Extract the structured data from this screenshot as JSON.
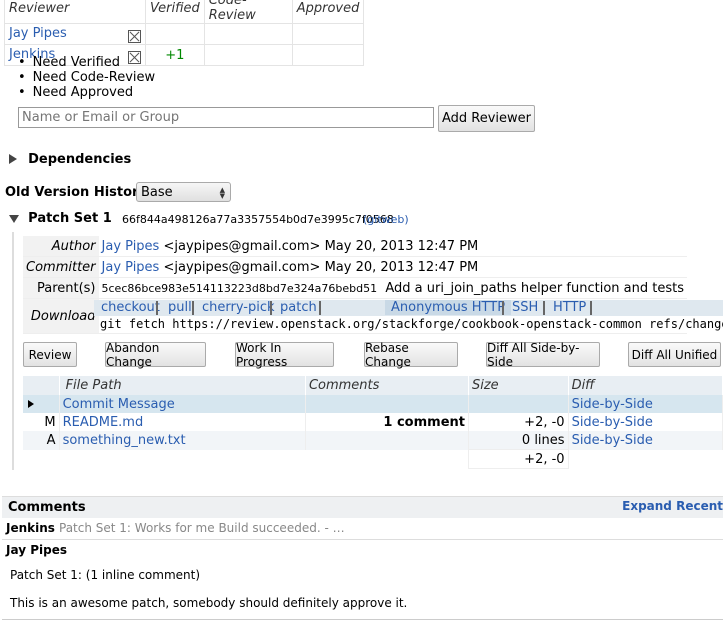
{
  "reviewers": {
    "headers": [
      "Reviewer",
      "Verified",
      "Code-Review",
      "Approved"
    ],
    "rows": [
      {
        "name": "Jay Pipes",
        "verified": ""
      },
      {
        "name": "Jenkins",
        "verified": "+1"
      }
    ],
    "needs": [
      "Need Verified",
      "Need Code-Review",
      "Need Approved"
    ],
    "input_placeholder": "Name or Email or Group",
    "add_button": "Add Reviewer"
  },
  "dependencies_label": "Dependencies",
  "old_version": {
    "label": "Old Version History:",
    "selected": "Base"
  },
  "patch_set": {
    "title": "Patch Set 1",
    "commit": "66f844a498126a77a3357554b0d7e3995c7f0568",
    "gitweb": "(gitweb)",
    "author_label": "Author",
    "author_name": "Jay Pipes",
    "author_rest": "<jaypipes@gmail.com> May 20, 2013 12:47 PM",
    "committer_label": "Committer",
    "committer_name": "Jay Pipes",
    "committer_rest": "<jaypipes@gmail.com> May 20, 2013 12:47 PM",
    "parent_label": "Parent(s)",
    "parent_hash": "5cec86bce983e514113223d8bd7e324a76bebd51",
    "parent_msg": "Add a uri_join_paths helper function and tests",
    "download_label": "Download",
    "download_tabs": [
      "checkout",
      "pull",
      "cherry-pick",
      "patch",
      "Anonymous HTTP",
      "SSH",
      "HTTP"
    ],
    "download_cmd": "git fetch https://review.openstack.org/stackforge/cookbook-openstack-common refs/changes/"
  },
  "actions": [
    "Review",
    "Abandon Change",
    "Work In Progress",
    "Rebase Change",
    "Diff All Side-by-Side",
    "Diff All Unified"
  ],
  "files": {
    "headers": [
      "File Path",
      "Comments",
      "Size",
      "Diff"
    ],
    "rows": [
      {
        "status": "",
        "path": "Commit Message",
        "comments": "",
        "size": "",
        "diff": "Side-by-Side"
      },
      {
        "status": "M",
        "path": "README.md",
        "comments": "1 comment",
        "size": "+2, -0",
        "diff": "Side-by-Side"
      },
      {
        "status": "A",
        "path": "something_new.txt",
        "comments": "",
        "size": "0 lines",
        "diff": "Side-by-Side"
      }
    ],
    "total": "+2, -0"
  },
  "comments": {
    "title": "Comments",
    "expand": "Expand Recent",
    "items": [
      {
        "author": "Jenkins",
        "summary": "Patch Set 1: Works for me Build succeeded. - …"
      },
      {
        "author": "Jay Pipes",
        "line1": "Patch Set 1: (1 inline comment)",
        "line2": "This is an awesome patch, somebody should definitely approve it."
      }
    ]
  }
}
